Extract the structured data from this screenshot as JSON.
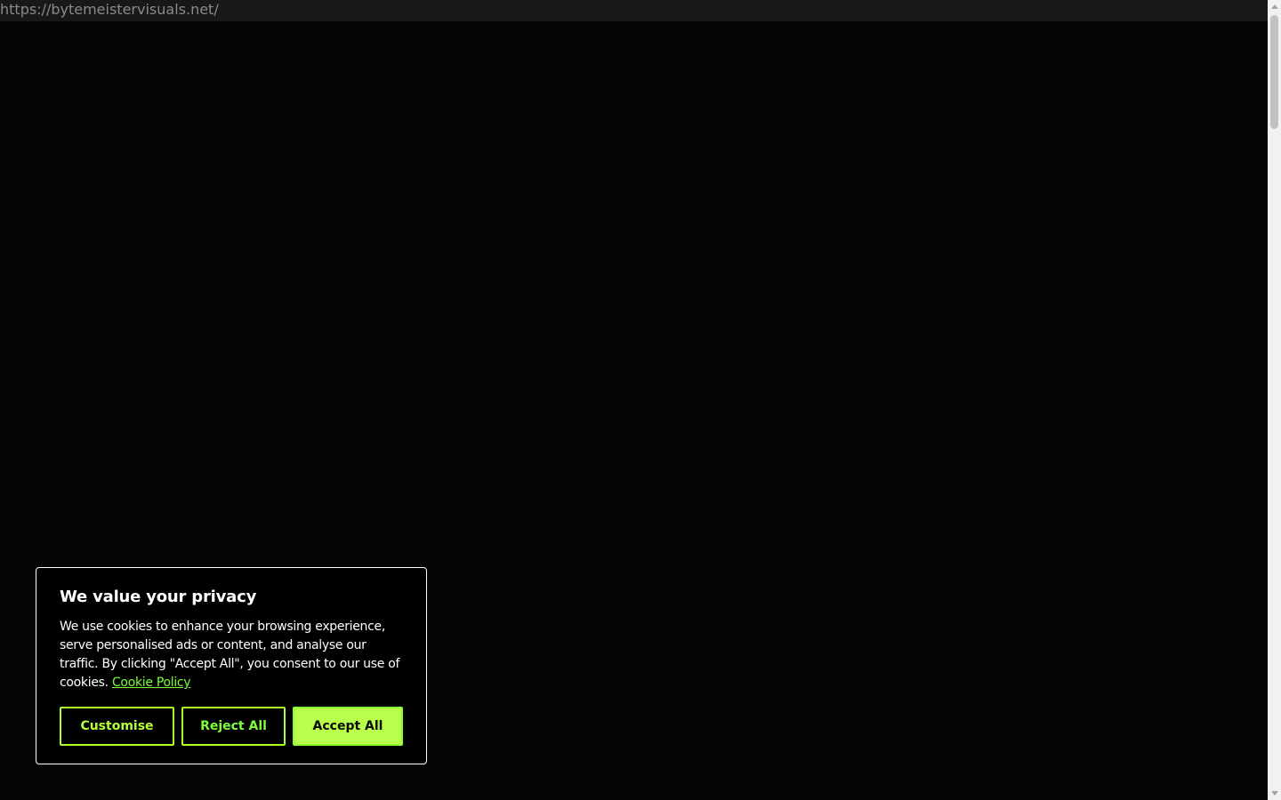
{
  "browser": {
    "url": "https://bytemeistervisuals.net/"
  },
  "cookie_banner": {
    "title": "We value your privacy",
    "body": "We use cookies to enhance your browsing experience, serve personalised ads or content, and analyse our traffic. By clicking \"Accept All\", you consent to our use of cookies.",
    "policy_link": "Cookie Policy",
    "buttons": {
      "customise": "Customise",
      "reject_all": "Reject All",
      "accept_all": "Accept All"
    }
  },
  "colors": {
    "background": "#050505",
    "accent_green": "#b7ff4a",
    "link_green": "#7cff3a",
    "card_border": "#ffffff"
  },
  "icons": {
    "scroll_up": "chevron-up-icon",
    "scroll_down": "chevron-down-icon"
  }
}
